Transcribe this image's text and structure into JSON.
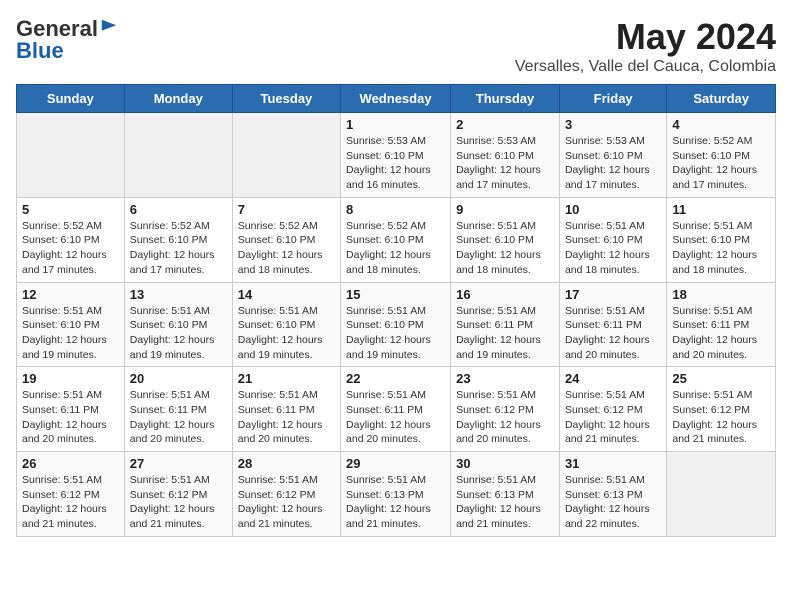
{
  "header": {
    "logo_line1": "General",
    "logo_line2": "Blue",
    "main_title": "May 2024",
    "subtitle": "Versalles, Valle del Cauca, Colombia"
  },
  "days_of_week": [
    "Sunday",
    "Monday",
    "Tuesday",
    "Wednesday",
    "Thursday",
    "Friday",
    "Saturday"
  ],
  "weeks": [
    [
      {
        "day": "",
        "info": ""
      },
      {
        "day": "",
        "info": ""
      },
      {
        "day": "",
        "info": ""
      },
      {
        "day": "1",
        "info": "Sunrise: 5:53 AM\nSunset: 6:10 PM\nDaylight: 12 hours\nand 16 minutes."
      },
      {
        "day": "2",
        "info": "Sunrise: 5:53 AM\nSunset: 6:10 PM\nDaylight: 12 hours\nand 17 minutes."
      },
      {
        "day": "3",
        "info": "Sunrise: 5:53 AM\nSunset: 6:10 PM\nDaylight: 12 hours\nand 17 minutes."
      },
      {
        "day": "4",
        "info": "Sunrise: 5:52 AM\nSunset: 6:10 PM\nDaylight: 12 hours\nand 17 minutes."
      }
    ],
    [
      {
        "day": "5",
        "info": "Sunrise: 5:52 AM\nSunset: 6:10 PM\nDaylight: 12 hours\nand 17 minutes."
      },
      {
        "day": "6",
        "info": "Sunrise: 5:52 AM\nSunset: 6:10 PM\nDaylight: 12 hours\nand 17 minutes."
      },
      {
        "day": "7",
        "info": "Sunrise: 5:52 AM\nSunset: 6:10 PM\nDaylight: 12 hours\nand 18 minutes."
      },
      {
        "day": "8",
        "info": "Sunrise: 5:52 AM\nSunset: 6:10 PM\nDaylight: 12 hours\nand 18 minutes."
      },
      {
        "day": "9",
        "info": "Sunrise: 5:51 AM\nSunset: 6:10 PM\nDaylight: 12 hours\nand 18 minutes."
      },
      {
        "day": "10",
        "info": "Sunrise: 5:51 AM\nSunset: 6:10 PM\nDaylight: 12 hours\nand 18 minutes."
      },
      {
        "day": "11",
        "info": "Sunrise: 5:51 AM\nSunset: 6:10 PM\nDaylight: 12 hours\nand 18 minutes."
      }
    ],
    [
      {
        "day": "12",
        "info": "Sunrise: 5:51 AM\nSunset: 6:10 PM\nDaylight: 12 hours\nand 19 minutes."
      },
      {
        "day": "13",
        "info": "Sunrise: 5:51 AM\nSunset: 6:10 PM\nDaylight: 12 hours\nand 19 minutes."
      },
      {
        "day": "14",
        "info": "Sunrise: 5:51 AM\nSunset: 6:10 PM\nDaylight: 12 hours\nand 19 minutes."
      },
      {
        "day": "15",
        "info": "Sunrise: 5:51 AM\nSunset: 6:10 PM\nDaylight: 12 hours\nand 19 minutes."
      },
      {
        "day": "16",
        "info": "Sunrise: 5:51 AM\nSunset: 6:11 PM\nDaylight: 12 hours\nand 19 minutes."
      },
      {
        "day": "17",
        "info": "Sunrise: 5:51 AM\nSunset: 6:11 PM\nDaylight: 12 hours\nand 20 minutes."
      },
      {
        "day": "18",
        "info": "Sunrise: 5:51 AM\nSunset: 6:11 PM\nDaylight: 12 hours\nand 20 minutes."
      }
    ],
    [
      {
        "day": "19",
        "info": "Sunrise: 5:51 AM\nSunset: 6:11 PM\nDaylight: 12 hours\nand 20 minutes."
      },
      {
        "day": "20",
        "info": "Sunrise: 5:51 AM\nSunset: 6:11 PM\nDaylight: 12 hours\nand 20 minutes."
      },
      {
        "day": "21",
        "info": "Sunrise: 5:51 AM\nSunset: 6:11 PM\nDaylight: 12 hours\nand 20 minutes."
      },
      {
        "day": "22",
        "info": "Sunrise: 5:51 AM\nSunset: 6:11 PM\nDaylight: 12 hours\nand 20 minutes."
      },
      {
        "day": "23",
        "info": "Sunrise: 5:51 AM\nSunset: 6:12 PM\nDaylight: 12 hours\nand 20 minutes."
      },
      {
        "day": "24",
        "info": "Sunrise: 5:51 AM\nSunset: 6:12 PM\nDaylight: 12 hours\nand 21 minutes."
      },
      {
        "day": "25",
        "info": "Sunrise: 5:51 AM\nSunset: 6:12 PM\nDaylight: 12 hours\nand 21 minutes."
      }
    ],
    [
      {
        "day": "26",
        "info": "Sunrise: 5:51 AM\nSunset: 6:12 PM\nDaylight: 12 hours\nand 21 minutes."
      },
      {
        "day": "27",
        "info": "Sunrise: 5:51 AM\nSunset: 6:12 PM\nDaylight: 12 hours\nand 21 minutes."
      },
      {
        "day": "28",
        "info": "Sunrise: 5:51 AM\nSunset: 6:12 PM\nDaylight: 12 hours\nand 21 minutes."
      },
      {
        "day": "29",
        "info": "Sunrise: 5:51 AM\nSunset: 6:13 PM\nDaylight: 12 hours\nand 21 minutes."
      },
      {
        "day": "30",
        "info": "Sunrise: 5:51 AM\nSunset: 6:13 PM\nDaylight: 12 hours\nand 21 minutes."
      },
      {
        "day": "31",
        "info": "Sunrise: 5:51 AM\nSunset: 6:13 PM\nDaylight: 12 hours\nand 22 minutes."
      },
      {
        "day": "",
        "info": ""
      }
    ]
  ]
}
